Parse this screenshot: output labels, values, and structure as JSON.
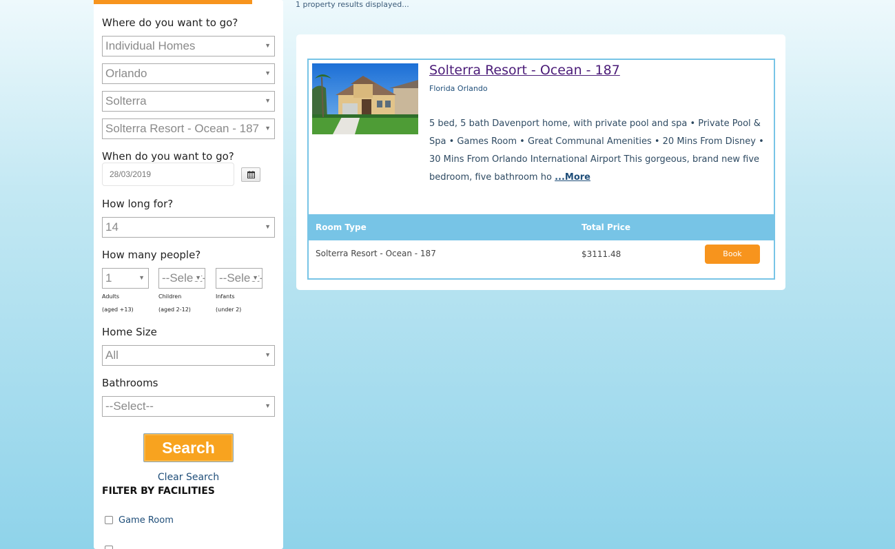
{
  "results_text": "1 property results displayed...",
  "sidebar": {
    "where_label": "Where do you want to go?",
    "property_type": "Individual Homes",
    "city": "Orlando",
    "resort": "Solterra",
    "property": "Solterra Resort - Ocean - 187",
    "when_label": "When do you want to go?",
    "date": "28/03/2019",
    "how_long_label": "How long for?",
    "nights": "14",
    "people_label": "How many people?",
    "adults_value": "1",
    "children_value": "--Select--",
    "infants_value": "--Select--",
    "adults_label": "Adults",
    "adults_sub": "(aged +13)",
    "children_label": "Children",
    "children_sub": "(aged 2-12)",
    "infants_label": "Infants",
    "infants_sub": "(under 2)",
    "home_size_label": "Home Size",
    "home_size_value": "All",
    "bathrooms_label": "Bathrooms",
    "bathrooms_value": "--Select--",
    "search_label": "Search",
    "clear_label": "Clear Search",
    "filter_title": "FILTER BY FACILITIES",
    "facilities": [
      "Game Room"
    ]
  },
  "property": {
    "title": "Solterra Resort - Ocean - 187",
    "location": "Florida Orlando",
    "description": "5 bed, 5 bath Davenport home, with private pool and spa • Private Pool & Spa • Games Room • Great Communal Amenities • 20 Mins From Disney • 30 Mins From Orlando International Airport This gorgeous, brand new five bedroom, five bathroom ho",
    "more_label": "...More",
    "table_headers": [
      "Room Type",
      "Total Price"
    ],
    "rooms": [
      {
        "type": "Solterra Resort - Ocean - 187",
        "price": "$3111.48",
        "action": "Book"
      }
    ]
  },
  "colors": {
    "accent": "#f7941d",
    "table_header": "#77c4e6",
    "title_link": "#4b1c78"
  }
}
